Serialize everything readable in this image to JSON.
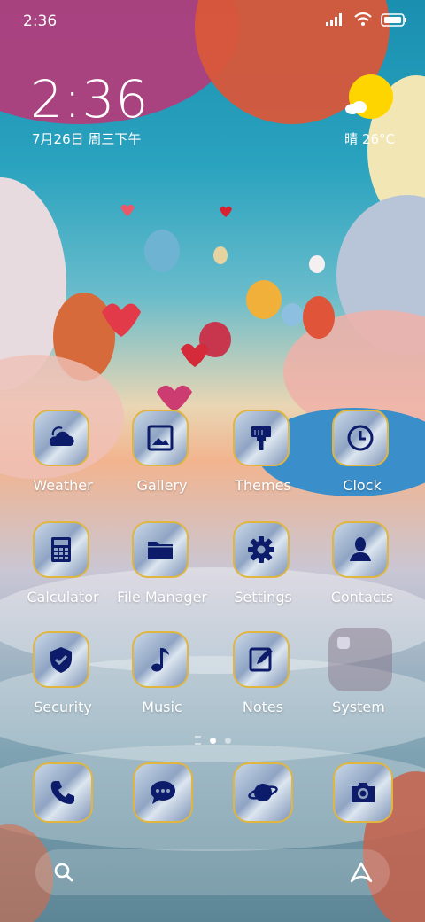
{
  "status_bar": {
    "time": "2:36",
    "icons": [
      "signal-icon",
      "wifi-icon",
      "battery-icon"
    ]
  },
  "clock_widget": {
    "time": "2:36",
    "date": "7月26日 周三下午"
  },
  "weather_widget": {
    "condition": "晴",
    "temperature": "26°C",
    "icon": "sunny-cloud-icon"
  },
  "apps": [
    {
      "label": "Weather",
      "icon": "weather-icon"
    },
    {
      "label": "Gallery",
      "icon": "gallery-icon"
    },
    {
      "label": "Themes",
      "icon": "paintbrush-icon"
    },
    {
      "label": "Clock",
      "icon": "clock-icon"
    },
    {
      "label": "Calculator",
      "icon": "calculator-icon"
    },
    {
      "label": "File Manager",
      "icon": "folder-icon"
    },
    {
      "label": "Settings",
      "icon": "gear-icon"
    },
    {
      "label": "Contacts",
      "icon": "person-icon"
    },
    {
      "label": "Security",
      "icon": "shield-icon"
    },
    {
      "label": "Music",
      "icon": "music-note-icon"
    },
    {
      "label": "Notes",
      "icon": "notepad-icon"
    },
    {
      "label": "System",
      "icon": "folder-icon"
    }
  ],
  "page_indicator": {
    "pages": 2,
    "current": 1
  },
  "dock": [
    {
      "icon": "phone-icon"
    },
    {
      "icon": "message-icon"
    },
    {
      "icon": "browser-planet-icon"
    },
    {
      "icon": "camera-icon"
    }
  ],
  "search_bar": {
    "left_icon": "search-icon",
    "right_icon": "assistant-icon"
  },
  "colors": {
    "icon_glyph": "#0d1b6b",
    "icon_border": "#e0b640",
    "sun": "#ffd500"
  }
}
